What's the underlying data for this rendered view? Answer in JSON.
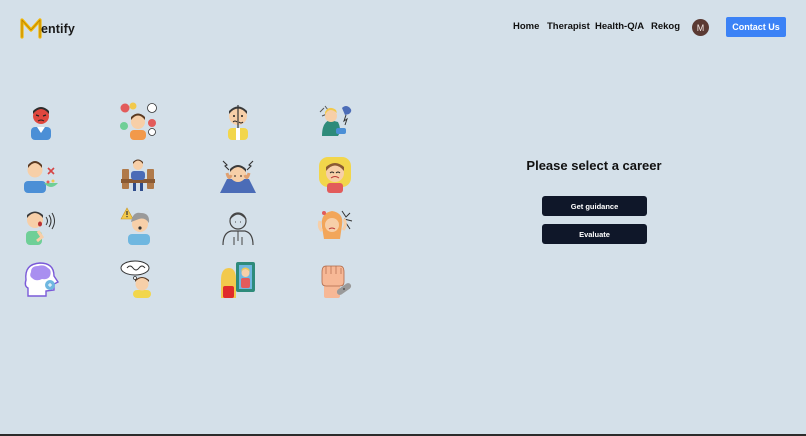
{
  "brand": {
    "initial": "M",
    "rest": "entify"
  },
  "nav": {
    "items": [
      "Home",
      "Therapist",
      "Health-Q/A",
      "Rekog"
    ],
    "avatar_initial": "M",
    "contact_label": "Contact Us"
  },
  "icons": [
    "angry-man-icon",
    "confused-chat-icon",
    "split-face-icon",
    "sad-sitting-icon",
    "eating-disorder-icon",
    "lonely-bench-icon",
    "headache-stress-icon",
    "crying-girl-icon",
    "shouting-man-icon",
    "anxiety-warning-icon",
    "ghost-person-icon",
    "hair-pulling-icon",
    "brain-head-icon",
    "thinking-person-icon",
    "mirror-selfie-icon",
    "fist-bandage-icon"
  ],
  "main": {
    "heading": "Please select a career",
    "guidance_label": "Get guidance",
    "evaluate_label": "Evaluate"
  },
  "colors": {
    "background": "#d4e0e9",
    "contact_button": "#3b82f6",
    "action_button": "#0f1729",
    "avatar": "#5b3a33",
    "logo": "#f2b705"
  }
}
